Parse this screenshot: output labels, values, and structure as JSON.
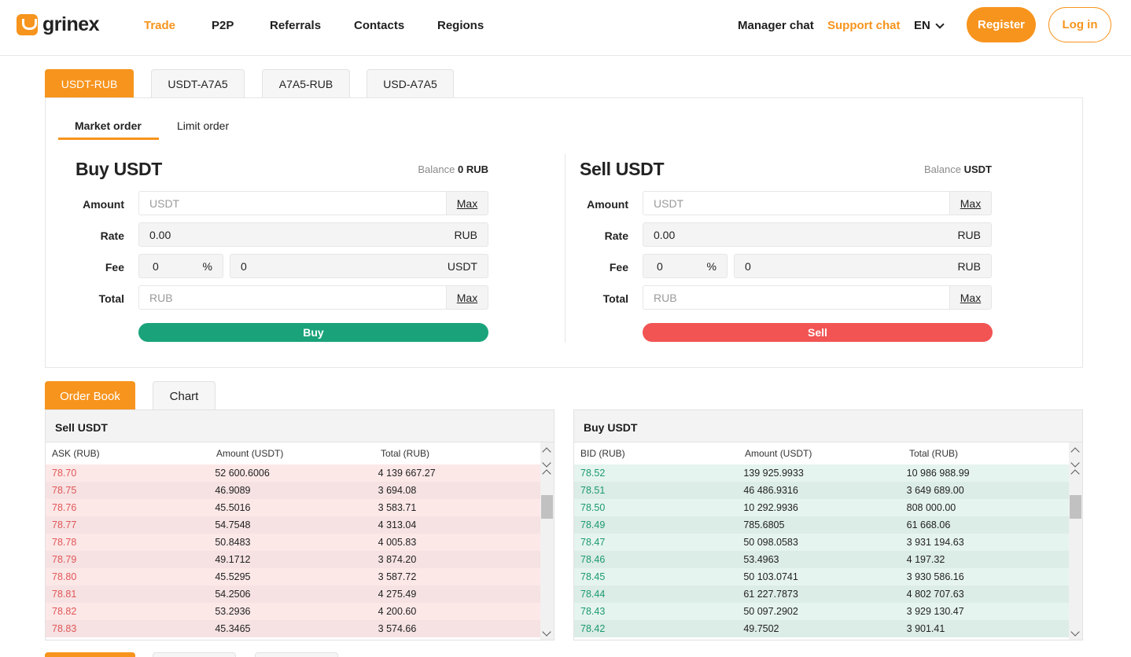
{
  "header": {
    "logo_text": "grinex",
    "nav": [
      {
        "label": "Trade",
        "active": true
      },
      {
        "label": "P2P",
        "active": false
      },
      {
        "label": "Referrals",
        "active": false
      },
      {
        "label": "Contacts",
        "active": false
      },
      {
        "label": "Regions",
        "active": false
      }
    ],
    "manager_chat": "Manager chat",
    "support_chat": "Support chat",
    "language": "EN",
    "register": "Register",
    "login": "Log in"
  },
  "pair_tabs": [
    "USDT-RUB",
    "USDT-A7A5",
    "A7A5-RUB",
    "USD-A7A5"
  ],
  "order_tabs": {
    "market": "Market order",
    "limit": "Limit order"
  },
  "buy": {
    "title": "Buy USDT",
    "balance_label": "Balance",
    "balance_value": "0 RUB",
    "labels": {
      "amount": "Amount",
      "rate": "Rate",
      "fee": "Fee",
      "total": "Total"
    },
    "amount_placeholder": "USDT",
    "max": "Max",
    "rate_value": "0.00",
    "rate_unit": "RUB",
    "fee_percent": "0",
    "fee_percent_unit": "%",
    "fee_value": "0",
    "fee_unit": "USDT",
    "total_placeholder": "RUB",
    "action": "Buy"
  },
  "sell": {
    "title": "Sell USDT",
    "balance_label": "Balance",
    "balance_value": "USDT",
    "labels": {
      "amount": "Amount",
      "rate": "Rate",
      "fee": "Fee",
      "total": "Total"
    },
    "amount_placeholder": "USDT",
    "max": "Max",
    "rate_value": "0.00",
    "rate_unit": "RUB",
    "fee_percent": "0",
    "fee_percent_unit": "%",
    "fee_value": "0",
    "fee_unit": "RUB",
    "total_placeholder": "RUB",
    "action": "Sell"
  },
  "book_tabs": [
    "Order Book",
    "Chart"
  ],
  "asks": {
    "title": "Sell USDT",
    "columns": [
      "ASK (RUB)",
      "Amount (USDT)",
      "Total (RUB)"
    ],
    "rows": [
      [
        "78.70",
        "52 600.6006",
        "4 139 667.27"
      ],
      [
        "78.75",
        "46.9089",
        "3 694.08"
      ],
      [
        "78.76",
        "45.5016",
        "3 583.71"
      ],
      [
        "78.77",
        "54.7548",
        "4 313.04"
      ],
      [
        "78.78",
        "50.8483",
        "4 005.83"
      ],
      [
        "78.79",
        "49.1712",
        "3 874.20"
      ],
      [
        "78.80",
        "45.5295",
        "3 587.72"
      ],
      [
        "78.81",
        "54.2506",
        "4 275.49"
      ],
      [
        "78.82",
        "53.2936",
        "4 200.60"
      ],
      [
        "78.83",
        "45.3465",
        "3 574.66"
      ]
    ]
  },
  "bids": {
    "title": "Buy USDT",
    "columns": [
      "BID (RUB)",
      "Amount (USDT)",
      "Total (RUB)"
    ],
    "rows": [
      [
        "78.52",
        "139 925.9933",
        "10 986 988.99"
      ],
      [
        "78.51",
        "46 486.9316",
        "3 649 689.00"
      ],
      [
        "78.50",
        "10 292.9936",
        "808 000.00"
      ],
      [
        "78.49",
        "785.6805",
        "61 668.06"
      ],
      [
        "78.47",
        "50 098.0583",
        "3 931 194.63"
      ],
      [
        "78.46",
        "53.4963",
        "4 197.32"
      ],
      [
        "78.45",
        "50 103.0741",
        "3 930 586.16"
      ],
      [
        "78.44",
        "61 227.7873",
        "4 802 707.63"
      ],
      [
        "78.43",
        "50 097.2902",
        "3 929 130.47"
      ],
      [
        "78.42",
        "49.7502",
        "3 901.41"
      ]
    ]
  }
}
